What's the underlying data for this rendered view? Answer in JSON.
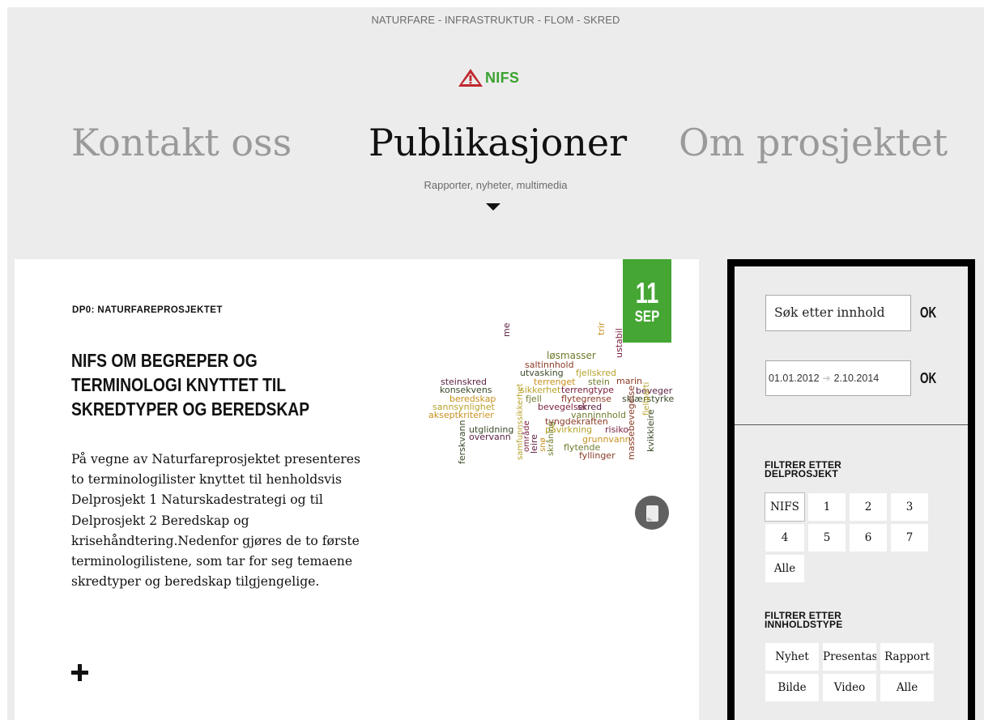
{
  "header": {
    "tagline": "NATURFARE - INFRASTRUKTUR - FLOM - SKRED",
    "logo_text": "NIFS",
    "subtitle": "Rapporter, nyheter, multimedia"
  },
  "nav": {
    "items": [
      {
        "label": "Kontakt oss"
      },
      {
        "label": "Publikasjoner"
      },
      {
        "label": "Om prosjektet"
      }
    ]
  },
  "article": {
    "category": "DP0: NATURFAREPROSJEKTET",
    "title": "NIFS OM BEGREPER OG TERMINOLOGI KNYTTET TIL SKREDTYPER OG BEREDSKAP",
    "body": "På vegne av Naturfareprosjektet presenteres to terminologilister knyttet til henholdsvis Delprosjekt 1 Naturskadestrategi og til Delprosjekt 2 Beredskap og krisehåndtering.Nedenfor gjøres de to første terminologilistene, som tar for seg temaene skredtyper og beredskap tilgjengelige.",
    "date_day": "11",
    "date_month": "SEP",
    "wordcloud_words": [
      "mekanisk",
      "trinnvis",
      "løsmasser",
      "saltinnhold",
      "utvasking",
      "fjellskred",
      "ustabil",
      "steinskred",
      "terrenget",
      "stein",
      "marin",
      "konsekvens",
      "sikkerhet",
      "terrengtype",
      "beveger",
      "beredskap",
      "fjell",
      "flytegrense",
      "sklærstyrke",
      "sannsynlighet",
      "bevegelser",
      "skred",
      "akseptkriterier",
      "vanninnhold",
      "tyngdekraften",
      "utglidning",
      "påvirkning",
      "risiko",
      "overvann",
      "grunnvann",
      "flytende",
      "fyllinger",
      "ferskvann",
      "samfunnssikkerhet",
      "område",
      "leire",
      "snø",
      "skråning",
      "massebevegelse",
      "kvikkleire",
      "fjellparti"
    ]
  },
  "sidebar": {
    "search_placeholder": "Søk etter innhold",
    "ok_label": "OK",
    "date_from": "01.01.2012",
    "date_to": "2.10.2014",
    "filter_subproject_title": "FILTRER ETTER DELPROSJEKT",
    "subprojects": [
      "NIFS",
      "1",
      "2",
      "3",
      "4",
      "5",
      "6",
      "7",
      "Alle"
    ],
    "filter_type_title": "FILTRER ETTER INNHOLDSTYPE",
    "content_types": [
      "Nyhet",
      "Presentasjon",
      "Rapport",
      "Bilde",
      "Video",
      "Alle"
    ]
  },
  "colors": {
    "accent_green": "#45a634",
    "logo_green": "#3aa22e",
    "logo_red": "#c0282d",
    "background": "#ececec"
  },
  "icons": [
    "warning-triangle-icon",
    "caret-down-icon",
    "document-icon",
    "plus-icon",
    "arrow-right-icon"
  ]
}
